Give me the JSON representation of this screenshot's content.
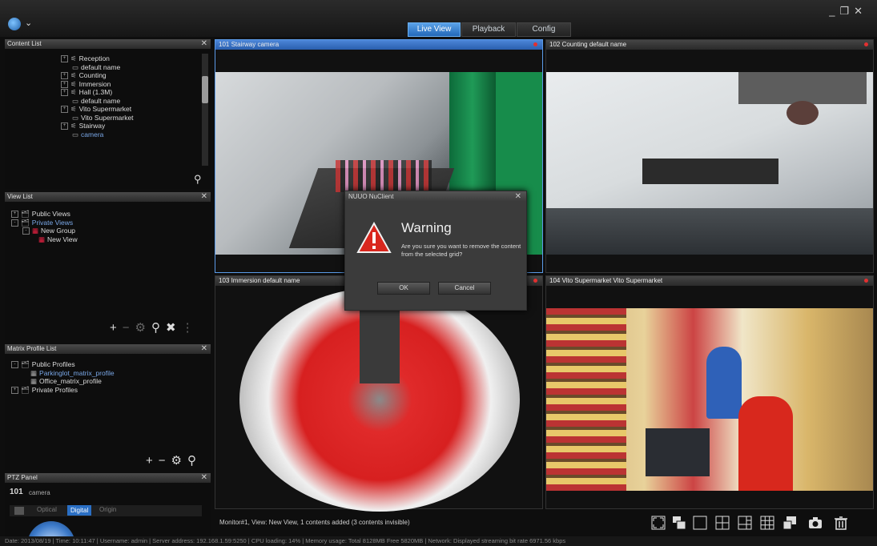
{
  "app": {
    "tabs": [
      {
        "label": "Live View",
        "active": true
      },
      {
        "label": "Playback",
        "active": false
      },
      {
        "label": "Config",
        "active": false
      }
    ],
    "window_controls": [
      "_",
      "❐",
      "✕"
    ]
  },
  "content_list": {
    "title": "Content List",
    "items": [
      {
        "label": "Reception",
        "type": "group"
      },
      {
        "label": "default name",
        "type": "camera"
      },
      {
        "label": "Counting",
        "type": "group"
      },
      {
        "label": "Immersion",
        "type": "group"
      },
      {
        "label": "Hall (1.3M)",
        "type": "group"
      },
      {
        "label": "default name",
        "type": "camera"
      },
      {
        "label": "Vito Supermarket",
        "type": "group"
      },
      {
        "label": "Vito Supermarket",
        "type": "camera"
      },
      {
        "label": "Stairway",
        "type": "group"
      },
      {
        "label": "camera",
        "type": "camera"
      }
    ]
  },
  "view_list": {
    "title": "View List",
    "items": [
      {
        "label": "Public Views"
      },
      {
        "label": "Private Views"
      },
      {
        "label": "New Group"
      },
      {
        "label": "New View"
      }
    ]
  },
  "matrix_profile_list": {
    "title": "Matrix Profile List",
    "items": [
      {
        "label": "Public Profiles"
      },
      {
        "label": "Parkinglot_matrix_profile"
      },
      {
        "label": "Office_matrix_profile"
      },
      {
        "label": "Private Profiles"
      }
    ]
  },
  "ptz_panel": {
    "title": "PTZ Panel",
    "camera_id": "101",
    "camera_name": "camera",
    "modes": [
      "Optical",
      "Digital",
      "Origin"
    ],
    "active_mode": "Digital"
  },
  "video_grid": [
    {
      "id": "101",
      "title": "101 Stairway  camera",
      "selected": true
    },
    {
      "id": "102",
      "title": "102  Counting  default name",
      "selected": false
    },
    {
      "id": "103",
      "title": "103  Immersion  default name",
      "selected": false
    },
    {
      "id": "104",
      "title": "104  Vito Supermarket  Vito Supermarket",
      "selected": false
    }
  ],
  "dialog": {
    "window_title": "NUUO NuClient",
    "heading": "Warning",
    "message": "Are you sure you want to remove the content from the selected grid?",
    "ok_label": "OK",
    "cancel_label": "Cancel"
  },
  "monitor_status": "Monitor#1, View: New View, 1 contents added (3 contents invisible)",
  "status_bar": "Date: 2013/08/19  |  Time: 10:11:47  |  Username: admin  |  Server address: 192.168.1.59:5250  |  CPU loading: 14%  |  Memory usage: Total 8128MB  Free 5820MB  |  Network: Displayed streaming bit rate 6971.56 kbps",
  "colors": {
    "accent": "#2a6fc4",
    "record": "#e23030",
    "background": "#0e0e0e"
  }
}
